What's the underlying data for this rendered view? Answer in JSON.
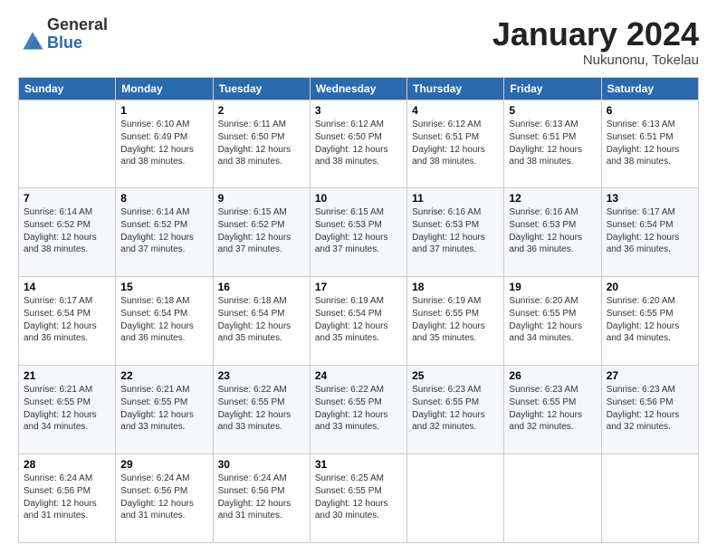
{
  "logo": {
    "general": "General",
    "blue": "Blue"
  },
  "header": {
    "month": "January 2024",
    "location": "Nukunonu, Tokelau"
  },
  "weekdays": [
    "Sunday",
    "Monday",
    "Tuesday",
    "Wednesday",
    "Thursday",
    "Friday",
    "Saturday"
  ],
  "weeks": [
    [
      {
        "day": "",
        "sunrise": "",
        "sunset": "",
        "daylight": ""
      },
      {
        "day": "1",
        "sunrise": "Sunrise: 6:10 AM",
        "sunset": "Sunset: 6:49 PM",
        "daylight": "Daylight: 12 hours and 38 minutes."
      },
      {
        "day": "2",
        "sunrise": "Sunrise: 6:11 AM",
        "sunset": "Sunset: 6:50 PM",
        "daylight": "Daylight: 12 hours and 38 minutes."
      },
      {
        "day": "3",
        "sunrise": "Sunrise: 6:12 AM",
        "sunset": "Sunset: 6:50 PM",
        "daylight": "Daylight: 12 hours and 38 minutes."
      },
      {
        "day": "4",
        "sunrise": "Sunrise: 6:12 AM",
        "sunset": "Sunset: 6:51 PM",
        "daylight": "Daylight: 12 hours and 38 minutes."
      },
      {
        "day": "5",
        "sunrise": "Sunrise: 6:13 AM",
        "sunset": "Sunset: 6:51 PM",
        "daylight": "Daylight: 12 hours and 38 minutes."
      },
      {
        "day": "6",
        "sunrise": "Sunrise: 6:13 AM",
        "sunset": "Sunset: 6:51 PM",
        "daylight": "Daylight: 12 hours and 38 minutes."
      }
    ],
    [
      {
        "day": "7",
        "sunrise": "Sunrise: 6:14 AM",
        "sunset": "Sunset: 6:52 PM",
        "daylight": "Daylight: 12 hours and 38 minutes."
      },
      {
        "day": "8",
        "sunrise": "Sunrise: 6:14 AM",
        "sunset": "Sunset: 6:52 PM",
        "daylight": "Daylight: 12 hours and 37 minutes."
      },
      {
        "day": "9",
        "sunrise": "Sunrise: 6:15 AM",
        "sunset": "Sunset: 6:52 PM",
        "daylight": "Daylight: 12 hours and 37 minutes."
      },
      {
        "day": "10",
        "sunrise": "Sunrise: 6:15 AM",
        "sunset": "Sunset: 6:53 PM",
        "daylight": "Daylight: 12 hours and 37 minutes."
      },
      {
        "day": "11",
        "sunrise": "Sunrise: 6:16 AM",
        "sunset": "Sunset: 6:53 PM",
        "daylight": "Daylight: 12 hours and 37 minutes."
      },
      {
        "day": "12",
        "sunrise": "Sunrise: 6:16 AM",
        "sunset": "Sunset: 6:53 PM",
        "daylight": "Daylight: 12 hours and 36 minutes."
      },
      {
        "day": "13",
        "sunrise": "Sunrise: 6:17 AM",
        "sunset": "Sunset: 6:54 PM",
        "daylight": "Daylight: 12 hours and 36 minutes."
      }
    ],
    [
      {
        "day": "14",
        "sunrise": "Sunrise: 6:17 AM",
        "sunset": "Sunset: 6:54 PM",
        "daylight": "Daylight: 12 hours and 36 minutes."
      },
      {
        "day": "15",
        "sunrise": "Sunrise: 6:18 AM",
        "sunset": "Sunset: 6:54 PM",
        "daylight": "Daylight: 12 hours and 36 minutes."
      },
      {
        "day": "16",
        "sunrise": "Sunrise: 6:18 AM",
        "sunset": "Sunset: 6:54 PM",
        "daylight": "Daylight: 12 hours and 35 minutes."
      },
      {
        "day": "17",
        "sunrise": "Sunrise: 6:19 AM",
        "sunset": "Sunset: 6:54 PM",
        "daylight": "Daylight: 12 hours and 35 minutes."
      },
      {
        "day": "18",
        "sunrise": "Sunrise: 6:19 AM",
        "sunset": "Sunset: 6:55 PM",
        "daylight": "Daylight: 12 hours and 35 minutes."
      },
      {
        "day": "19",
        "sunrise": "Sunrise: 6:20 AM",
        "sunset": "Sunset: 6:55 PM",
        "daylight": "Daylight: 12 hours and 34 minutes."
      },
      {
        "day": "20",
        "sunrise": "Sunrise: 6:20 AM",
        "sunset": "Sunset: 6:55 PM",
        "daylight": "Daylight: 12 hours and 34 minutes."
      }
    ],
    [
      {
        "day": "21",
        "sunrise": "Sunrise: 6:21 AM",
        "sunset": "Sunset: 6:55 PM",
        "daylight": "Daylight: 12 hours and 34 minutes."
      },
      {
        "day": "22",
        "sunrise": "Sunrise: 6:21 AM",
        "sunset": "Sunset: 6:55 PM",
        "daylight": "Daylight: 12 hours and 33 minutes."
      },
      {
        "day": "23",
        "sunrise": "Sunrise: 6:22 AM",
        "sunset": "Sunset: 6:55 PM",
        "daylight": "Daylight: 12 hours and 33 minutes."
      },
      {
        "day": "24",
        "sunrise": "Sunrise: 6:22 AM",
        "sunset": "Sunset: 6:55 PM",
        "daylight": "Daylight: 12 hours and 33 minutes."
      },
      {
        "day": "25",
        "sunrise": "Sunrise: 6:23 AM",
        "sunset": "Sunset: 6:55 PM",
        "daylight": "Daylight: 12 hours and 32 minutes."
      },
      {
        "day": "26",
        "sunrise": "Sunrise: 6:23 AM",
        "sunset": "Sunset: 6:55 PM",
        "daylight": "Daylight: 12 hours and 32 minutes."
      },
      {
        "day": "27",
        "sunrise": "Sunrise: 6:23 AM",
        "sunset": "Sunset: 6:56 PM",
        "daylight": "Daylight: 12 hours and 32 minutes."
      }
    ],
    [
      {
        "day": "28",
        "sunrise": "Sunrise: 6:24 AM",
        "sunset": "Sunset: 6:56 PM",
        "daylight": "Daylight: 12 hours and 31 minutes."
      },
      {
        "day": "29",
        "sunrise": "Sunrise: 6:24 AM",
        "sunset": "Sunset: 6:56 PM",
        "daylight": "Daylight: 12 hours and 31 minutes."
      },
      {
        "day": "30",
        "sunrise": "Sunrise: 6:24 AM",
        "sunset": "Sunset: 6:56 PM",
        "daylight": "Daylight: 12 hours and 31 minutes."
      },
      {
        "day": "31",
        "sunrise": "Sunrise: 6:25 AM",
        "sunset": "Sunset: 6:55 PM",
        "daylight": "Daylight: 12 hours and 30 minutes."
      },
      {
        "day": "",
        "sunrise": "",
        "sunset": "",
        "daylight": ""
      },
      {
        "day": "",
        "sunrise": "",
        "sunset": "",
        "daylight": ""
      },
      {
        "day": "",
        "sunrise": "",
        "sunset": "",
        "daylight": ""
      }
    ]
  ]
}
